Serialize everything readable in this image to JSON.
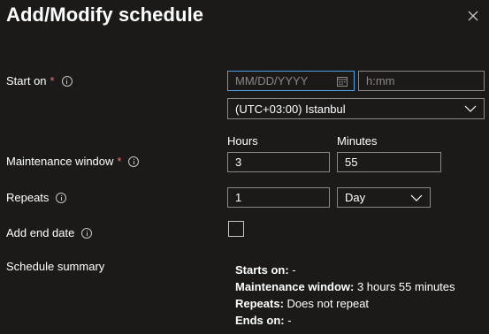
{
  "header": {
    "title": "Add/Modify schedule"
  },
  "fields": {
    "start_on": {
      "label": "Start on",
      "required": "*",
      "date_placeholder": "MM/DD/YYYY",
      "time_placeholder": "h:mm",
      "timezone": "(UTC+03:00) Istanbul"
    },
    "maintenance_window": {
      "label": "Maintenance window",
      "required": "*",
      "hours_label": "Hours",
      "minutes_label": "Minutes",
      "hours": "3",
      "minutes": "55"
    },
    "repeats": {
      "label": "Repeats",
      "count": "1",
      "unit": "Day"
    },
    "add_end_date": {
      "label": "Add end date",
      "checked": false
    }
  },
  "summary": {
    "label": "Schedule summary",
    "starts_on_key": "Starts on:",
    "starts_on_val": " -",
    "window_key": "Maintenance window:",
    "window_val": " 3 hours 55 minutes",
    "repeats_key": "Repeats:",
    "repeats_val": " Does not repeat",
    "ends_on_key": "Ends on:",
    "ends_on_val": " -"
  },
  "icons": [
    "close-icon",
    "info-icon",
    "calendar-icon",
    "chevron-down-icon"
  ]
}
